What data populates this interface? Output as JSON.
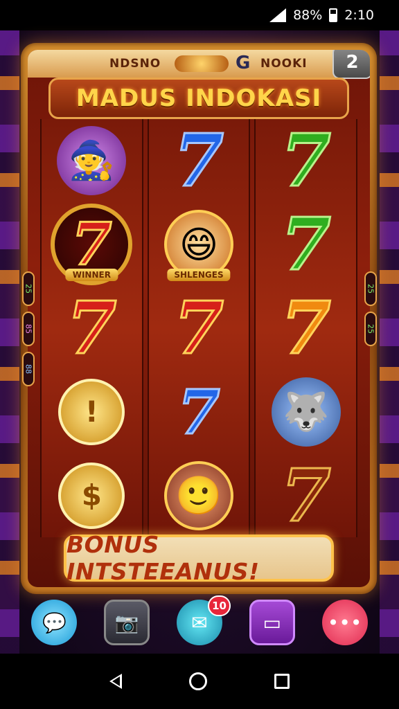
{
  "status": {
    "battery": "88%",
    "time": "2:10"
  },
  "top_bar": {
    "left_label": "NDSNO",
    "center_icon": "G",
    "right_label": "NOOKI",
    "menu_button": "2"
  },
  "title": "MADUS INDOKASI",
  "reels": [
    {
      "symbols": [
        "wizard-character",
        "red-seven-wreath",
        "red-seven",
        "gold-coin-badge",
        "gold-coins"
      ]
    },
    {
      "symbols": [
        "blue-seven",
        "hero-character",
        "red-seven",
        "blue-seven",
        "man-character-wreath"
      ]
    },
    {
      "symbols": [
        "green-seven",
        "green-seven",
        "orange-seven",
        "wolf-character",
        "dim-seven"
      ]
    }
  ],
  "symbol_labels": {
    "seven": "7",
    "wreath_banner": "WINNER",
    "hero_banner": "SHLENGES"
  },
  "side_pills": {
    "left": [
      "25",
      "85",
      "88"
    ],
    "right": [
      "25",
      "25"
    ]
  },
  "bonus_button": "BONUS INTSTEEANUS!",
  "actions": [
    {
      "name": "chat",
      "icon": "speech-bubble-icon"
    },
    {
      "name": "camera",
      "icon": "camera-icon"
    },
    {
      "name": "message",
      "icon": "message-icon",
      "badge": "10"
    },
    {
      "name": "tv",
      "icon": "tv-icon"
    },
    {
      "name": "more",
      "icon": "more-dots-icon"
    }
  ],
  "colors": {
    "frame_gold": "#d7902f",
    "reel_red": "#8d1f0c",
    "title_yellow": "#ffd54a",
    "bonus_text": "#b0300c"
  }
}
